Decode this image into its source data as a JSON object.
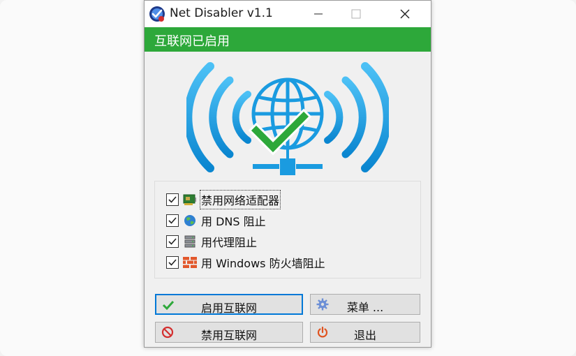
{
  "window": {
    "title": "Net Disabler v1.1"
  },
  "status": {
    "text": "互联网已启用",
    "color": "#2da83a"
  },
  "options": [
    {
      "label": "禁用网络适配器",
      "checked": true,
      "icon": "network-adapter-icon"
    },
    {
      "label": "用 DNS 阻止",
      "checked": true,
      "icon": "globe-icon"
    },
    {
      "label": "用代理阻止",
      "checked": true,
      "icon": "server-icon"
    },
    {
      "label": "用 Windows 防火墙阻止",
      "checked": true,
      "icon": "firewall-icon"
    }
  ],
  "buttons": {
    "enable": "启用互联网",
    "menu": "菜单 ...",
    "disable": "禁用互联网",
    "exit": "退出"
  },
  "colors": {
    "accent": "#1aa3e8",
    "check": "#2da83a",
    "focus": "#0078d7"
  }
}
